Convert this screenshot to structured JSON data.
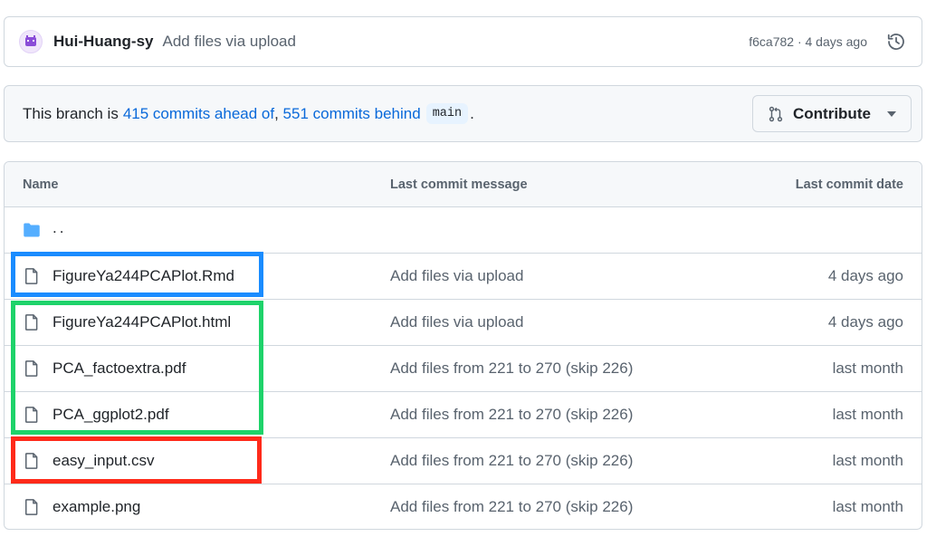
{
  "commit": {
    "author": "Hui-Huang-sy",
    "message": "Add files via upload",
    "sha_time": "f6ca782 · 4 days ago"
  },
  "branch": {
    "prefix": "This branch is ",
    "ahead": "415 commits ahead of",
    "sep": ", ",
    "behind": "551 commits behind",
    "base": "main",
    "suffix": ".",
    "contribute_label": "Contribute"
  },
  "table": {
    "headers": {
      "name": "Name",
      "message": "Last commit message",
      "date": "Last commit date"
    },
    "parent": "..",
    "rows": [
      {
        "name": "FigureYa244PCAPlot.Rmd",
        "message": "Add files via upload",
        "date": "4 days ago"
      },
      {
        "name": "FigureYa244PCAPlot.html",
        "message": "Add files via upload",
        "date": "4 days ago"
      },
      {
        "name": "PCA_factoextra.pdf",
        "message": "Add files from 221 to 270 (skip 226)",
        "date": "last month"
      },
      {
        "name": "PCA_ggplot2.pdf",
        "message": "Add files from 221 to 270 (skip 226)",
        "date": "last month"
      },
      {
        "name": "easy_input.csv",
        "message": "Add files from 221 to 270 (skip 226)",
        "date": "last month"
      },
      {
        "name": "example.png",
        "message": "Add files from 221 to 270 (skip 226)",
        "date": "last month"
      }
    ]
  },
  "colors": {
    "link": "#0969da",
    "highlight_blue": "#1a8cff",
    "highlight_green": "#1ed36a",
    "highlight_red": "#ff2a1a",
    "folder": "#54aeff"
  },
  "icons": {
    "avatar": "avatar-identicon",
    "history": "history-icon",
    "contribute": "git-pull-request-icon",
    "folder": "folder-icon",
    "file": "file-icon"
  }
}
